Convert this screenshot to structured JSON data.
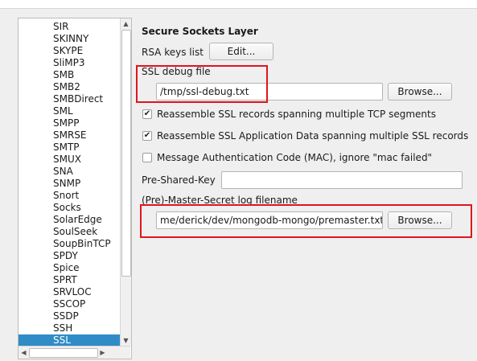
{
  "protocol_list": {
    "items": [
      "SIR",
      "SKINNY",
      "SKYPE",
      "SliMP3",
      "SMB",
      "SMB2",
      "SMBDirect",
      "SML",
      "SMPP",
      "SMRSE",
      "SMTP",
      "SMUX",
      "SNA",
      "SNMP",
      "Snort",
      "Socks",
      "SolarEdge",
      "SoulSeek",
      "SoupBinTCP",
      "SPDY",
      "Spice",
      "SPRT",
      "SRVLOC",
      "SSCOP",
      "SSDP",
      "SSH",
      "SSL"
    ],
    "selected": "SSL"
  },
  "ssl_prefs": {
    "section_title": "Secure Sockets Layer",
    "rsa_keys_label": "RSA keys list",
    "rsa_edit_button": "Edit...",
    "debug_file_label": "SSL debug file",
    "debug_file_value": "/tmp/ssl-debug.txt",
    "debug_browse_button": "Browse...",
    "checkboxes": [
      {
        "label": "Reassemble SSL records spanning multiple TCP segments",
        "checked": true,
        "mark": "✔"
      },
      {
        "label": "Reassemble SSL Application Data spanning multiple SSL records",
        "checked": true,
        "mark": "✔"
      },
      {
        "label": "Message Authentication Code (MAC), ignore \"mac failed\"",
        "checked": false,
        "mark": ""
      }
    ],
    "psk_label": "Pre-Shared-Key",
    "psk_value": "",
    "master_secret_label": "(Pre)-Master-Secret log filename",
    "master_secret_value": "me/derick/dev/mongodb-mongo/premaster.txt",
    "master_browse_button": "Browse..."
  },
  "accent_colors": {
    "selection": "#308cc6",
    "highlight": "#e0141e"
  }
}
